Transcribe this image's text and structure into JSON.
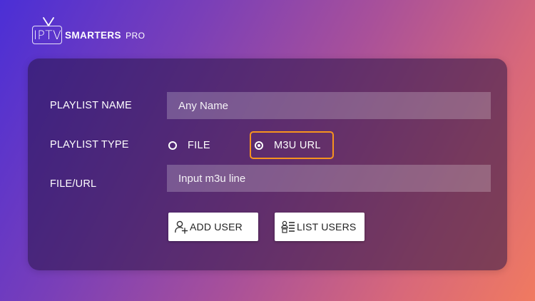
{
  "logo": {
    "iptv": "IPTV",
    "smarters": "SMARTERS",
    "pro": "PRO"
  },
  "form": {
    "playlist_name_label": "PLAYLIST NAME",
    "playlist_name_placeholder": "Any Name",
    "playlist_name_value": "",
    "playlist_type_label": "PLAYLIST TYPE",
    "type_options": [
      {
        "label": "FILE",
        "selected": false
      },
      {
        "label": "M3U URL",
        "selected": true
      }
    ],
    "file_url_label": "FILE/URL",
    "file_url_placeholder": "Input m3u line",
    "file_url_value": ""
  },
  "buttons": {
    "add_user_label": "ADD USER",
    "add_user_icon": "add-user-icon",
    "list_users_label": "LIST USERS",
    "list_users_icon": "list-users-icon"
  },
  "colors": {
    "focus_border": "#f7931e",
    "gradient_start": "#4b2fd6",
    "gradient_end": "#f07a60"
  }
}
